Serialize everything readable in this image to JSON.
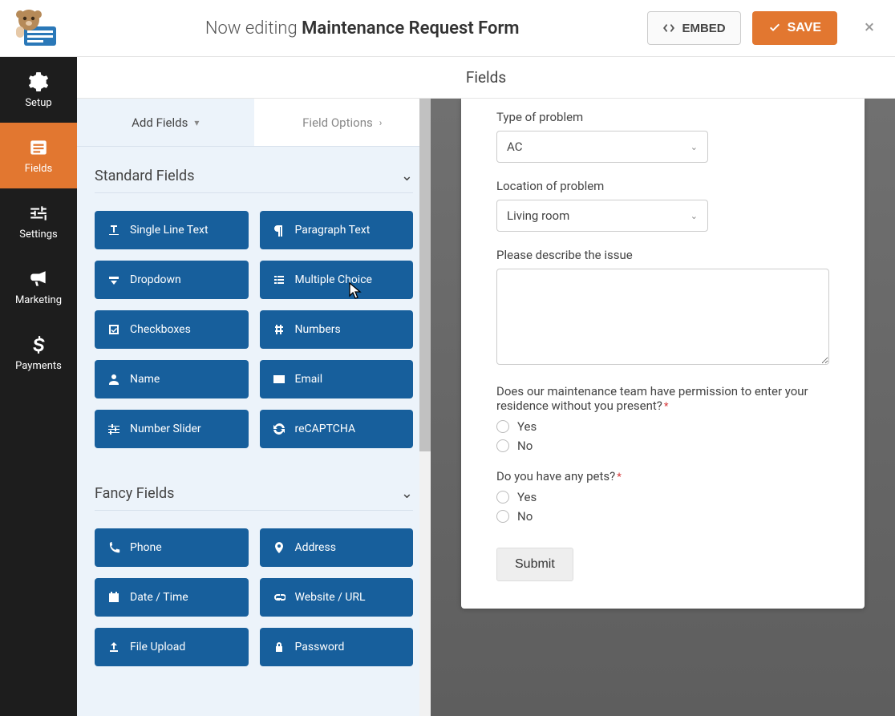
{
  "header": {
    "prefix": "Now editing",
    "form_name": "Maintenance Request Form",
    "embed_label": "EMBED",
    "save_label": "SAVE"
  },
  "sidebar": {
    "items": [
      {
        "id": "setup",
        "label": "Setup"
      },
      {
        "id": "fields",
        "label": "Fields"
      },
      {
        "id": "settings",
        "label": "Settings"
      },
      {
        "id": "marketing",
        "label": "Marketing"
      },
      {
        "id": "payments",
        "label": "Payments"
      }
    ],
    "active": "fields"
  },
  "panel": {
    "title": "Fields",
    "tabs": {
      "add": "Add Fields",
      "options": "Field Options"
    },
    "sections": {
      "standard": {
        "title": "Standard Fields",
        "fields": [
          "Single Line Text",
          "Paragraph Text",
          "Dropdown",
          "Multiple Choice",
          "Checkboxes",
          "Numbers",
          "Name",
          "Email",
          "Number Slider",
          "reCAPTCHA"
        ]
      },
      "fancy": {
        "title": "Fancy Fields",
        "fields": [
          "Phone",
          "Address",
          "Date / Time",
          "Website / URL",
          "File Upload",
          "Password"
        ]
      }
    }
  },
  "preview": {
    "type_label": "Type of problem",
    "type_value": "AC",
    "location_label": "Location of problem",
    "location_value": "Living room",
    "describe_label": "Please describe the issue",
    "permission_label": "Does our maintenance team have permission to enter your residence without you present?",
    "pets_label": "Do you have any pets?",
    "yes": "Yes",
    "no": "No",
    "submit": "Submit"
  },
  "colors": {
    "accent": "#e27730",
    "field_button": "#175f9c"
  }
}
